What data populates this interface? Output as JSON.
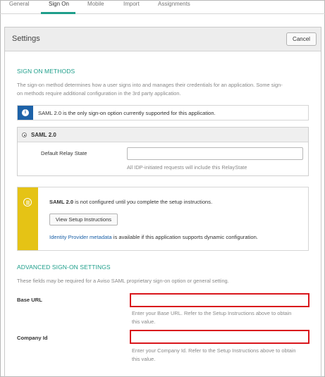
{
  "tabs": [
    {
      "label": "General"
    },
    {
      "label": "Sign On"
    },
    {
      "label": "Mobile"
    },
    {
      "label": "Import"
    },
    {
      "label": "Assignments"
    }
  ],
  "active_tab": "Sign On",
  "panel": {
    "title": "Settings",
    "cancel_label": "Cancel"
  },
  "sign_on_methods": {
    "title": "SIGN ON METHODS",
    "desc_line1": "The sign-on method determines how a user signs into and manages their credentials for an application. Some sign-",
    "desc_line2": "on methods require additional configuration in the 3rd party application."
  },
  "info_box": {
    "icon": "info-icon",
    "text": "SAML 2.0 is the only sign-on option currently supported for this application."
  },
  "saml": {
    "option_label": "SAML 2.0",
    "selected": true,
    "relay_label": "Default Relay State",
    "relay_value": "",
    "relay_hint": "All IDP-initiated requests will include this RelayState"
  },
  "warning_box": {
    "icon": "list-icon",
    "text_bold": "SAML 2.0",
    "text_rest": " is not configured until you complete the setup instructions.",
    "button_label": "View Setup Instructions",
    "link_text": "Identity Provider metadata",
    "link_rest": " is available if this application supports dynamic configuration."
  },
  "advanced": {
    "title": "ADVANCED SIGN-ON SETTINGS",
    "desc": "These fields may be required for a Aviso SAML proprietary sign-on option or general setting.",
    "base_url_label": "Base URL",
    "base_url_value": "",
    "base_url_hint_line1": "Enter your Base URL. Refer to the Setup Instructions above to obtain",
    "base_url_hint_line2": "this value.",
    "company_id_label": "Company Id",
    "company_id_value": "",
    "company_id_hint_line1": "Enter your Company Id. Refer to the Setup Instructions above to obtain",
    "company_id_hint_line2": "this value."
  },
  "colors": {
    "accent_teal": "#1d9e8a",
    "info_blue": "#1d62a8",
    "warn_yellow": "#e5c315",
    "highlight_red": "#d9161c"
  }
}
